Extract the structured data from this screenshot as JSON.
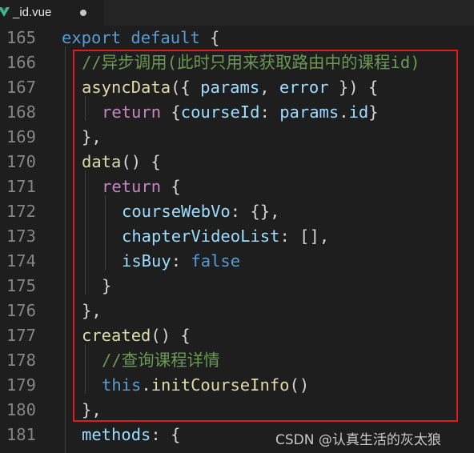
{
  "tab": {
    "filename": "_id.vue",
    "unsaved_indicator": "●"
  },
  "colors": {
    "background": "#1e1e1e",
    "keyword": "#569cd6",
    "control_keyword": "#c586c0",
    "function": "#dcdcaa",
    "variable": "#9cdcfe",
    "comment": "#6a9955",
    "highlight_box": "#e01b1b"
  },
  "lines": [
    {
      "num": "165",
      "tokens": [
        {
          "t": "export",
          "c": "kw"
        },
        {
          "t": " ",
          "c": "pun"
        },
        {
          "t": "default",
          "c": "kw"
        },
        {
          "t": " {",
          "c": "pun"
        }
      ]
    },
    {
      "num": "166",
      "tokens": [
        {
          "t": "//异步调用(此时只用来获取路由中的课程id)",
          "c": "cmt"
        }
      ]
    },
    {
      "num": "167",
      "tokens": [
        {
          "t": "asyncData",
          "c": "fn"
        },
        {
          "t": "({ ",
          "c": "pun"
        },
        {
          "t": "params",
          "c": "var"
        },
        {
          "t": ", ",
          "c": "pun"
        },
        {
          "t": "error",
          "c": "var"
        },
        {
          "t": " }) {",
          "c": "pun"
        }
      ]
    },
    {
      "num": "168",
      "tokens": [
        {
          "t": "return",
          "c": "kwc"
        },
        {
          "t": " {",
          "c": "pun"
        },
        {
          "t": "courseId",
          "c": "var"
        },
        {
          "t": ": ",
          "c": "pun"
        },
        {
          "t": "params",
          "c": "var"
        },
        {
          "t": ".",
          "c": "pun"
        },
        {
          "t": "id",
          "c": "var"
        },
        {
          "t": "}",
          "c": "pun"
        }
      ]
    },
    {
      "num": "169",
      "tokens": [
        {
          "t": "},",
          "c": "pun"
        }
      ]
    },
    {
      "num": "170",
      "tokens": [
        {
          "t": "data",
          "c": "fn"
        },
        {
          "t": "() {",
          "c": "pun"
        }
      ]
    },
    {
      "num": "171",
      "tokens": [
        {
          "t": "return",
          "c": "kwc"
        },
        {
          "t": " {",
          "c": "pun"
        }
      ]
    },
    {
      "num": "172",
      "tokens": [
        {
          "t": "courseWebVo",
          "c": "var"
        },
        {
          "t": ": {},",
          "c": "pun"
        }
      ]
    },
    {
      "num": "173",
      "tokens": [
        {
          "t": "chapterVideoList",
          "c": "var"
        },
        {
          "t": ": [],",
          "c": "pun"
        }
      ]
    },
    {
      "num": "174",
      "tokens": [
        {
          "t": "isBuy",
          "c": "var"
        },
        {
          "t": ": ",
          "c": "pun"
        },
        {
          "t": "false",
          "c": "kw"
        }
      ]
    },
    {
      "num": "175",
      "tokens": [
        {
          "t": "}",
          "c": "pun"
        }
      ]
    },
    {
      "num": "176",
      "tokens": [
        {
          "t": "},",
          "c": "pun"
        }
      ]
    },
    {
      "num": "177",
      "tokens": [
        {
          "t": "created",
          "c": "fn"
        },
        {
          "t": "() {",
          "c": "pun"
        }
      ]
    },
    {
      "num": "178",
      "tokens": [
        {
          "t": "//查询课程详情",
          "c": "cmt"
        }
      ]
    },
    {
      "num": "179",
      "tokens": [
        {
          "t": "this",
          "c": "kw"
        },
        {
          "t": ".",
          "c": "pun"
        },
        {
          "t": "initCourseInfo",
          "c": "fn"
        },
        {
          "t": "()",
          "c": "pun"
        }
      ]
    },
    {
      "num": "180",
      "tokens": [
        {
          "t": "},",
          "c": "pun"
        }
      ]
    },
    {
      "num": "181",
      "tokens": [
        {
          "t": "methods",
          "c": "var"
        },
        {
          "t": ": {",
          "c": "pun"
        }
      ]
    }
  ],
  "watermark": "CSDN @认真生活的灰太狼"
}
